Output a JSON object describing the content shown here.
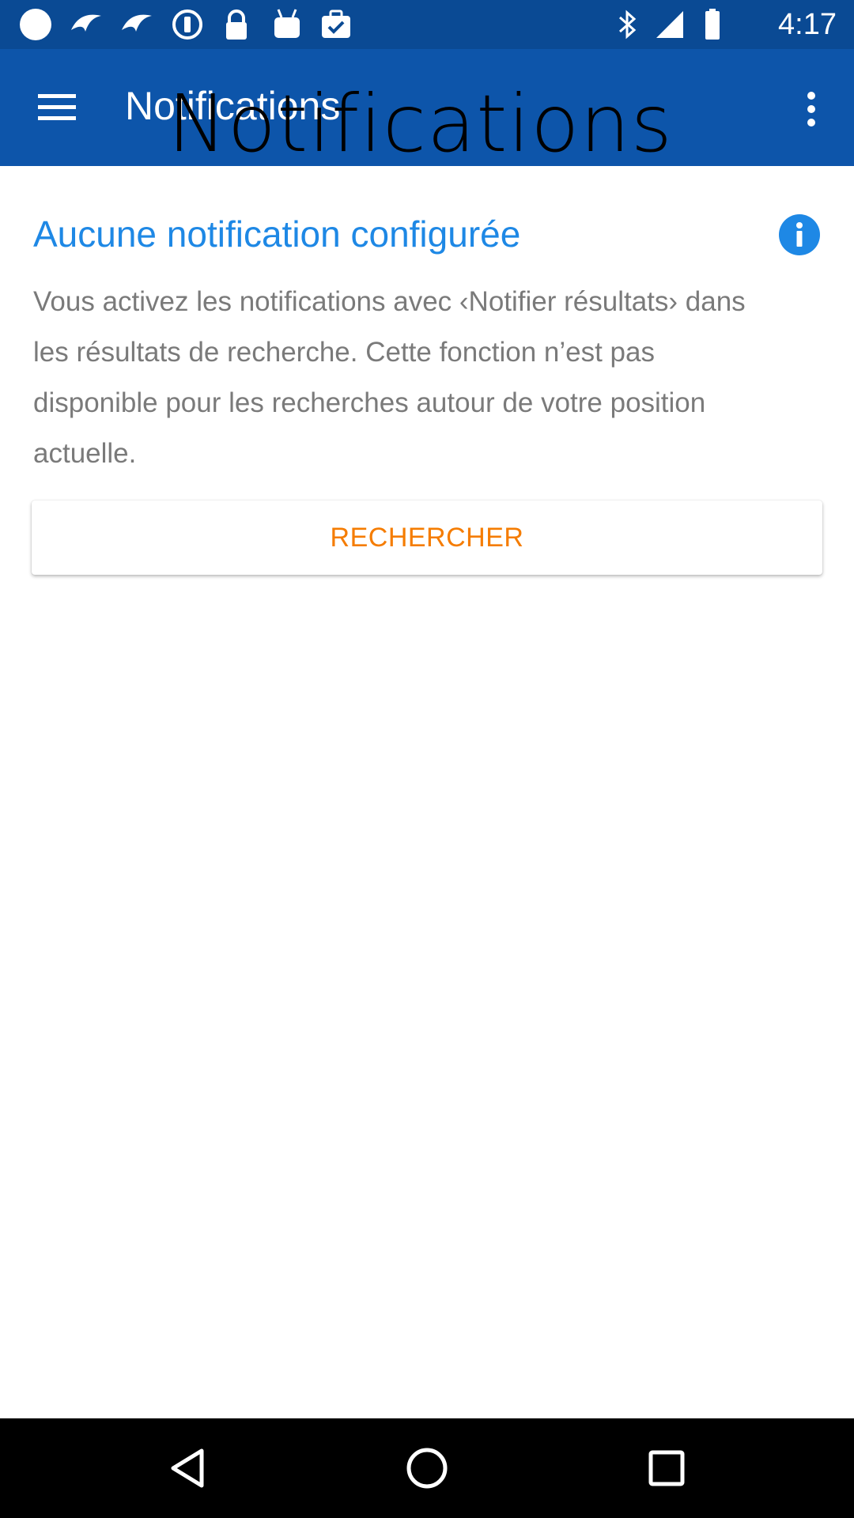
{
  "status_bar": {
    "time": "4:17",
    "icons": [
      "circle-icon",
      "wings-icon",
      "wings-icon",
      "alert-circle-icon",
      "lock-icon",
      "android-icon",
      "briefcase-check-icon",
      "bluetooth-icon",
      "signal-icon",
      "battery-icon"
    ]
  },
  "app_bar": {
    "title": "Notifications",
    "title_overlay": "Notifications",
    "menu_icon": "hamburger-menu-icon",
    "overflow_icon": "more-vert-icon"
  },
  "main": {
    "heading": "Aucune notification configurée",
    "info_icon": "info-icon",
    "description": "Vous activez les notifications avec ‹Notifier résultats› dans les résultats de recherche. Cette fonction n’est pas disponible pour les recherches autour de votre position actuelle.",
    "search_button_label": "RECHERCHER"
  },
  "nav_bar": {
    "icons": [
      "back-icon",
      "home-icon",
      "recents-icon"
    ]
  },
  "colors": {
    "status_bar": "#0a4a94",
    "app_bar": "#0d55aa",
    "heading": "#1e88e5",
    "button_text": "#f57c00",
    "body_text": "#7a7a7a"
  }
}
